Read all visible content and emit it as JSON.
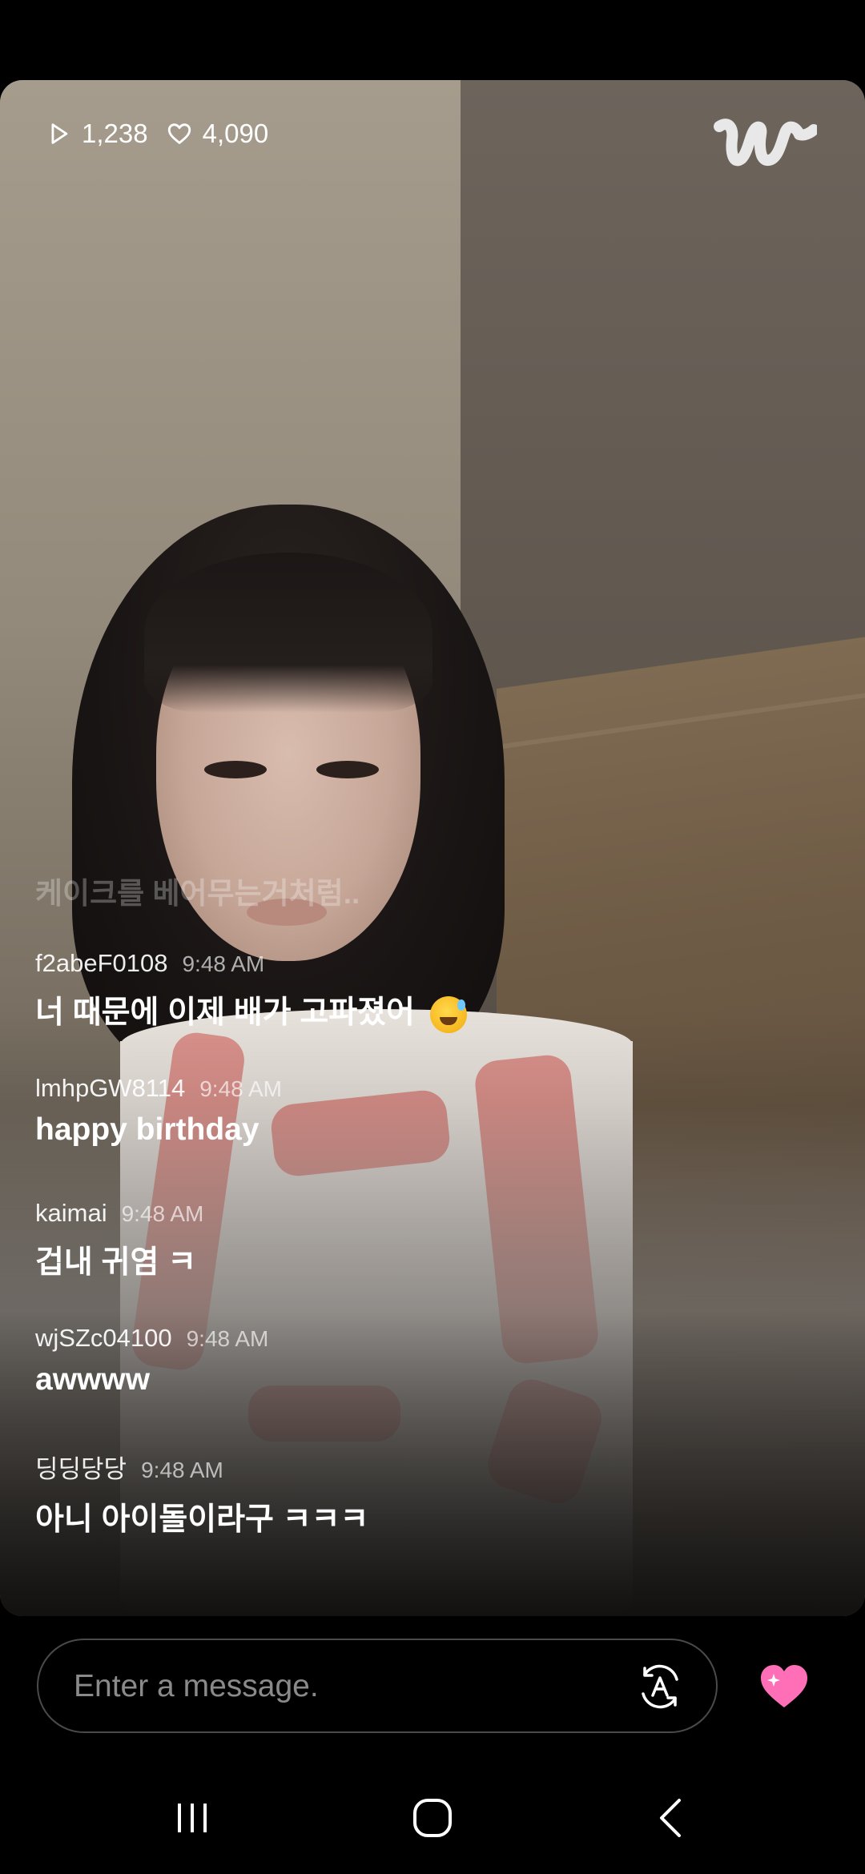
{
  "stream": {
    "play_count": "1,238",
    "like_count": "4,090",
    "logo": "w"
  },
  "chat": {
    "faded_message": "케이크를 베어무는거처럼..",
    "messages": [
      {
        "user": "f2abeF0108",
        "time": "9:48 AM",
        "text": "너 때문에 이제 배가 고파졌어",
        "emoji": "sweat-smile-emoji"
      },
      {
        "user": "lmhpGW8114",
        "time": "9:48 AM",
        "text": "happy birthday"
      },
      {
        "user": "kaimai",
        "time": "9:48 AM",
        "text": "겁내 귀염 ㅋ"
      },
      {
        "user": "wjSZc04100",
        "time": "9:48 AM",
        "text": "awwww"
      },
      {
        "user": "딩딩당당",
        "time": "9:48 AM",
        "text": "아니 아이돌이라구 ㅋㅋㅋ"
      }
    ]
  },
  "input": {
    "placeholder": "Enter a message."
  },
  "icons": {
    "play": "play-icon",
    "heart": "heart-outline-icon",
    "translate": "translate-icon",
    "like": "heart-sparkle-icon",
    "nav_recent": "recent-apps-icon",
    "nav_home": "home-icon",
    "nav_back": "back-icon"
  },
  "colors": {
    "accent_pink": "#ff6fb8",
    "background": "#000000"
  }
}
